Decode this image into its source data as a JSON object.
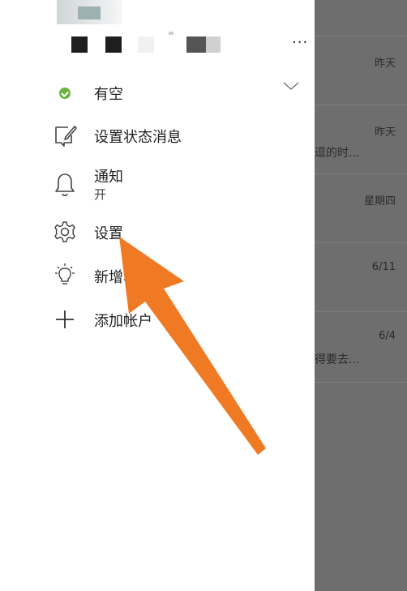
{
  "drawer": {
    "more_label": "···",
    "status": {
      "label": "有空"
    },
    "items": [
      {
        "label": "设置状态消息"
      },
      {
        "label": "通知",
        "sub": "开"
      },
      {
        "label": "设置"
      },
      {
        "label": "新增功能"
      },
      {
        "label": "添加帐户"
      }
    ]
  },
  "background_list": {
    "rows": [
      {
        "date": "昨天",
        "snippet": ""
      },
      {
        "date": "昨天",
        "snippet": "逗的时..."
      },
      {
        "date": "星期四",
        "snippet": ""
      },
      {
        "date": "6/11",
        "snippet": ""
      },
      {
        "date": "6/4",
        "snippet": "得要去..."
      }
    ]
  },
  "colors": {
    "status_green": "#6bb33e",
    "annotation_arrow": "#f07a24",
    "overlay_gray": "#6e6e6e"
  }
}
